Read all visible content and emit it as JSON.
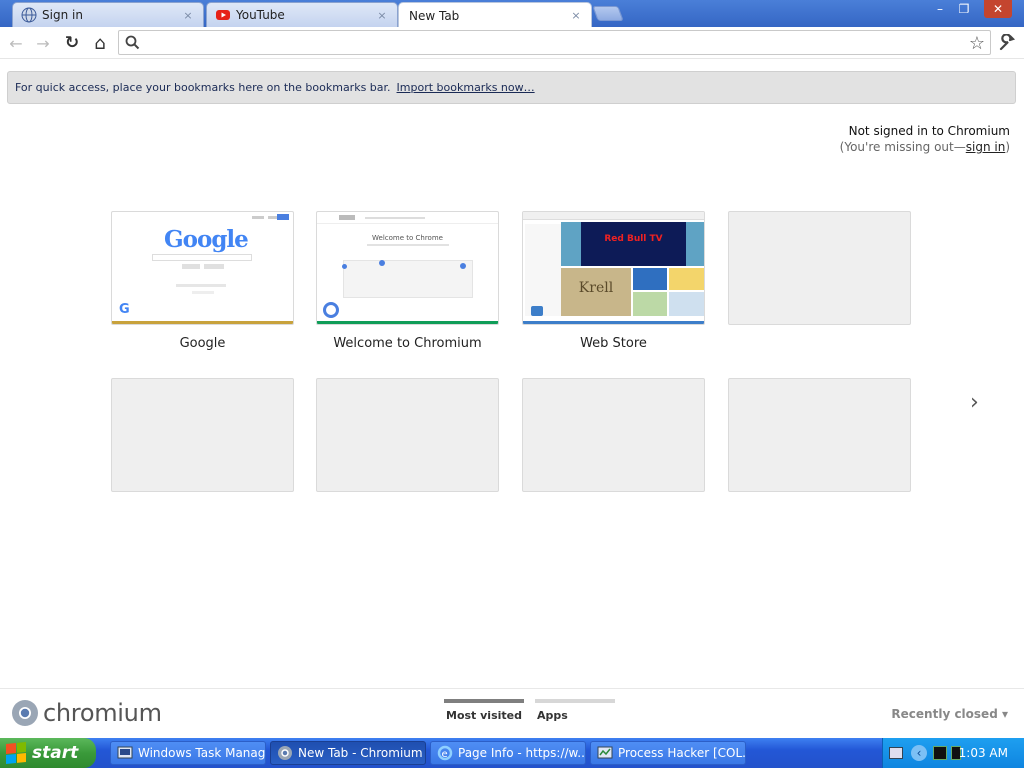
{
  "tabs": [
    {
      "label": "Sign in",
      "icon": "globe-icon",
      "active": false
    },
    {
      "label": "YouTube",
      "icon": "youtube-icon",
      "active": false
    },
    {
      "label": "New Tab",
      "icon": "",
      "active": true
    }
  ],
  "tab_close": "×",
  "window_controls": {
    "minimize": "–",
    "restore": "❐",
    "close": "✕"
  },
  "toolbar": {
    "back": "←",
    "forward": "→",
    "reload": "↻",
    "home": "⌂",
    "omnibox_value": "",
    "star": "☆",
    "wrench": "🔧"
  },
  "bookmark_bar": {
    "text": "For quick access, place your bookmarks here on the bookmarks bar.",
    "link": "Import bookmarks now…"
  },
  "signin": {
    "line1": "Not signed in to Chromium",
    "line2_prefix": "(You're missing out—",
    "link": "sign in",
    "line2_suffix": ")"
  },
  "most_visited": [
    {
      "title": "Google",
      "bar_color": "#c8a23c"
    },
    {
      "title": "Welcome to Chromium",
      "bar_color": "#0f9d58"
    },
    {
      "title": "Web Store",
      "bar_color": "#3d7ec9"
    }
  ],
  "google_thumb": {
    "logo": "Google"
  },
  "welcome_thumb": {
    "heading": "Welcome to Chrome"
  },
  "webstore_thumb": {
    "promo": "Red Bull TV",
    "tile": "Krell"
  },
  "pager": "›",
  "footer": {
    "brand": "chromium",
    "tabs": [
      "Most visited",
      "Apps"
    ],
    "recently_closed": "Recently closed ▾"
  },
  "taskbar": {
    "start": "start",
    "tasks": [
      {
        "label": "Windows Task Manager",
        "active": false
      },
      {
        "label": "New Tab - Chromium",
        "active": true
      },
      {
        "label": "Page Info - https://w...",
        "active": false
      },
      {
        "label": "Process Hacker [COL...",
        "active": false
      }
    ],
    "clock": "1:03 AM"
  },
  "colors": {
    "accent": "#3566c4",
    "taskbar": "#2357d6",
    "start": "#3a9a3a"
  }
}
